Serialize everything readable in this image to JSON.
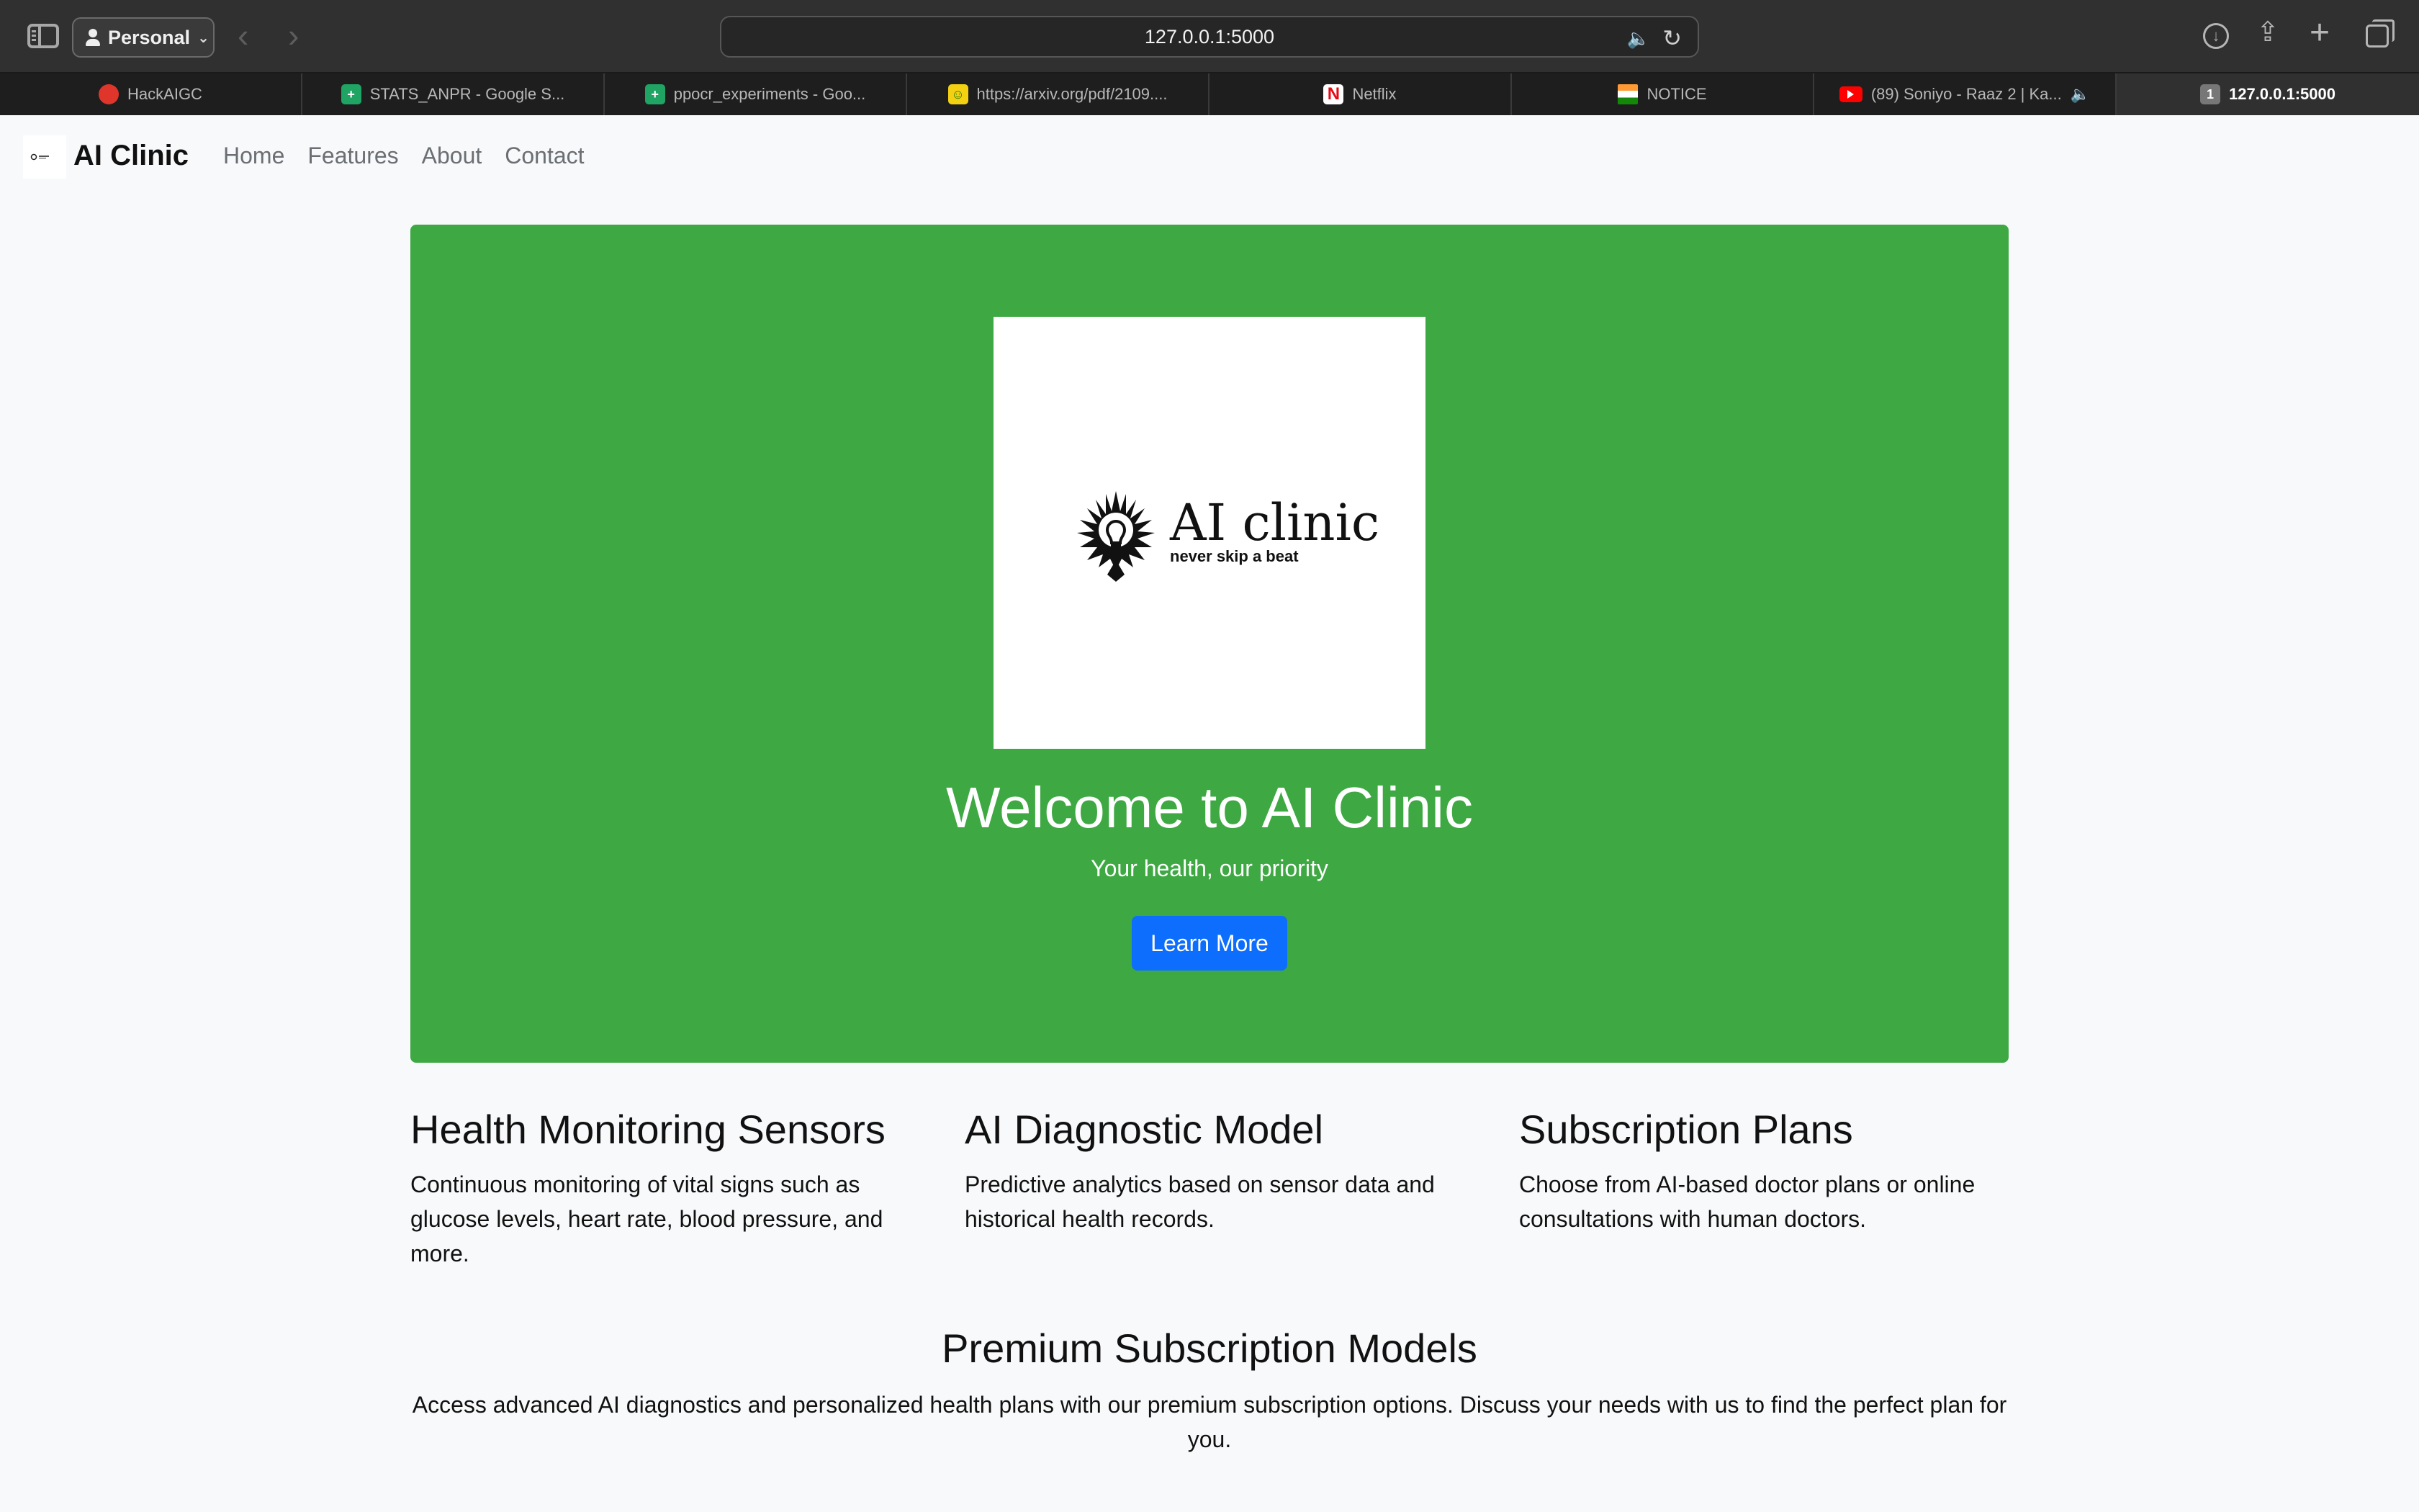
{
  "browser": {
    "profile_label": "Personal",
    "url": "127.0.0.1:5000",
    "tabs": [
      {
        "label": "HackAIGC",
        "favicon": "hackaigc-icon"
      },
      {
        "label": "STATS_ANPR - Google S...",
        "favicon": "google-sheets-icon"
      },
      {
        "label": "ppocr_experiments - Goo...",
        "favicon": "google-sheets-icon"
      },
      {
        "label": "https://arxiv.org/pdf/2109....",
        "favicon": "arxiv-icon"
      },
      {
        "label": "Netflix",
        "favicon": "netflix-icon"
      },
      {
        "label": "NOTICE",
        "favicon": "india-flag-icon"
      },
      {
        "label": "(89) Soniyo - Raaz 2 | Ka...",
        "favicon": "youtube-icon"
      },
      {
        "label": "127.0.0.1:5000",
        "favicon": "tab-number-icon",
        "badge": "1"
      }
    ]
  },
  "navbar": {
    "brand": "AI Clinic",
    "links": [
      "Home",
      "Features",
      "About",
      "Contact"
    ]
  },
  "hero": {
    "logo_text": "AI clinic",
    "logo_tagline": "never skip a beat",
    "title": "Welcome to AI Clinic",
    "subtitle": "Your health, our priority",
    "button_label": "Learn More"
  },
  "features": [
    {
      "title": "Health Monitoring Sensors",
      "text": "Continuous monitoring of vital signs such as glucose levels, heart rate, blood pressure, and more."
    },
    {
      "title": "AI Diagnostic Model",
      "text": "Predictive analytics based on sensor data and historical health records."
    },
    {
      "title": "Subscription Plans",
      "text": "Choose from AI-based doctor plans or online consultations with human doctors."
    }
  ],
  "premium": {
    "title": "Premium Subscription Models",
    "text": "Access advanced AI diagnostics and personalized health plans with our premium subscription options. Discuss your needs with us to find the perfect plan for you."
  },
  "colors": {
    "hero_bg": "#3ea843",
    "button": "#0d6efd",
    "page_bg": "#f8f9fa"
  }
}
